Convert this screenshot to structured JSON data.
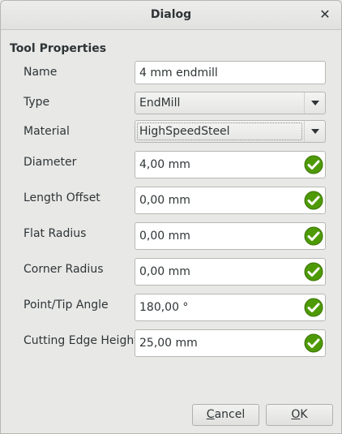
{
  "window": {
    "title": "Dialog"
  },
  "group": {
    "title": "Tool Properties"
  },
  "fields": {
    "name": {
      "label": "Name",
      "value": "4 mm endmill"
    },
    "type": {
      "label": "Type",
      "value": "EndMill"
    },
    "material": {
      "label": "Material",
      "value": "HighSpeedSteel"
    },
    "diameter": {
      "label": "Diameter",
      "value": "4,00 mm"
    },
    "length_offset": {
      "label": "Length Offset",
      "value": "0,00 mm"
    },
    "flat_radius": {
      "label": "Flat Radius",
      "value": "0,00 mm"
    },
    "corner_radius": {
      "label": "Corner Radius",
      "value": "0,00 mm"
    },
    "tip_angle": {
      "label": "Point/Tip Angle",
      "value": "180,00 °"
    },
    "cutting_edge_height": {
      "label": "Cutting Edge Height",
      "value": "25,00 mm"
    }
  },
  "buttons": {
    "cancel": {
      "mnemonic": "C",
      "rest": "ancel"
    },
    "ok": {
      "mnemonic": "O",
      "rest": "K"
    }
  },
  "colors": {
    "valid_check": "#4e9a06",
    "window_bg": "#e8e8e7"
  }
}
